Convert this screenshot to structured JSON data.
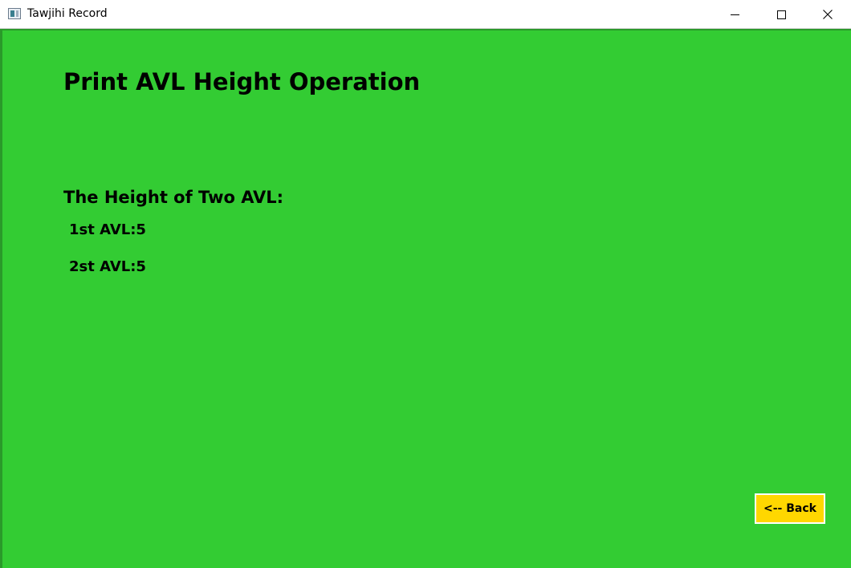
{
  "window": {
    "title": "Tawjihi Record",
    "controls": [
      "minimize-icon",
      "maximize-icon",
      "close-icon"
    ]
  },
  "page": {
    "heading": "Print AVL Height Operation",
    "subheading": "The Height of Two AVL:",
    "rows": [
      {
        "label": "1st AVL:5"
      },
      {
        "label": "2st AVL:5"
      }
    ],
    "back_label": "<-- Back"
  },
  "colors": {
    "background": "#33cc33",
    "button": "#ffd700",
    "text": "#000000"
  }
}
